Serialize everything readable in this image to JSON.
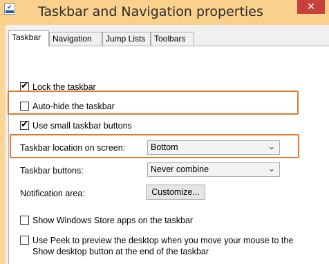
{
  "window": {
    "title": "Taskbar and Navigation properties",
    "close_glyph": "✕"
  },
  "tabs": [
    {
      "label": "Taskbar",
      "active": true
    },
    {
      "label": "Navigation",
      "active": false
    },
    {
      "label": "Jump Lists",
      "active": false
    },
    {
      "label": "Toolbars",
      "active": false
    }
  ],
  "options": {
    "lock_taskbar": {
      "label": "Lock the taskbar",
      "checked": true
    },
    "auto_hide": {
      "label": "Auto-hide the taskbar",
      "checked": false
    },
    "small_buttons": {
      "label": "Use small taskbar buttons",
      "checked": true
    },
    "store_apps": {
      "label": "Show Windows Store apps on the taskbar",
      "checked": false
    },
    "peek": {
      "label_line1": "Use Peek to preview the desktop when you move your mouse to the",
      "label_line2": "Show desktop button at the end of the taskbar",
      "checked": false
    }
  },
  "location": {
    "label": "Taskbar location on screen:",
    "value": "Bottom"
  },
  "buttons": {
    "label": "Taskbar buttons:",
    "value": "Never combine"
  },
  "notification": {
    "label": "Notification area:",
    "button": "Customize..."
  },
  "glyphs": {
    "check": "✔",
    "dropdown": "⌄"
  },
  "colors": {
    "highlight": "#e07a2e",
    "titlebar": "#f9d08c",
    "close": "#c7403a"
  }
}
